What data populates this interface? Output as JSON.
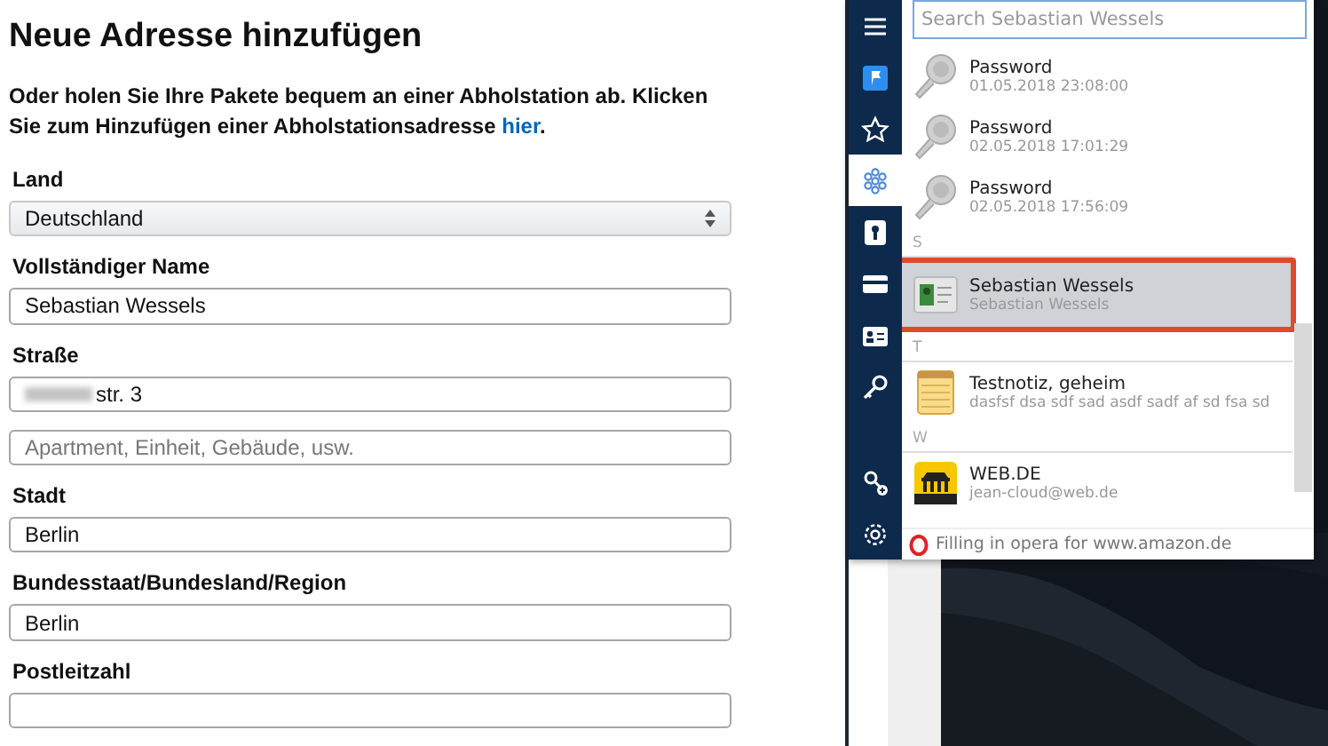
{
  "form": {
    "title": "Neue Adresse hinzufügen",
    "intro": "Oder holen Sie Ihre Pakete bequem an einer Abholstation ab. Klicken Sie zum Hinzufügen einer Abholstationsadresse",
    "intro_link": "hier",
    "intro_end": ".",
    "fields": [
      {
        "kind": "select",
        "label": "Land",
        "value": "Deutschland"
      },
      {
        "kind": "text",
        "label": "Vollständiger Name",
        "value": "Sebastian Wessels"
      },
      {
        "kind": "redacted",
        "label": "Straße",
        "value": "str. 3"
      },
      {
        "kind": "text",
        "placeholder": "Apartment, Einheit, Gebäude, usw."
      },
      {
        "kind": "text",
        "label": "Stadt",
        "value": "Berlin"
      },
      {
        "kind": "text",
        "label": "Bundesstaat/Bundesland/Region",
        "value": "Berlin"
      },
      {
        "kind": "text",
        "label": "Postleitzahl"
      }
    ]
  },
  "popup": {
    "sidebar": [
      {
        "kind": "menu",
        "selected": false
      },
      {
        "kind": "flag",
        "selected": false
      },
      {
        "kind": "star",
        "selected": false
      },
      {
        "kind": "network",
        "selected": true
      },
      {
        "kind": "keyhole",
        "selected": false
      },
      {
        "kind": "card",
        "selected": false
      },
      {
        "kind": "id",
        "selected": false
      },
      {
        "kind": "key",
        "selected": false
      },
      {
        "kind": "keyplus",
        "selected": false
      },
      {
        "kind": "settings",
        "selected": false
      }
    ],
    "search": {
      "placeholder": "Search Sebastian Wessels"
    },
    "items": [
      {
        "kind": "password",
        "title": "Password",
        "subtitle": "01.05.2018 23:08:00",
        "selected": false
      },
      {
        "kind": "password",
        "title": "Password",
        "subtitle": "02.05.2018 17:01:29",
        "selected": false
      },
      {
        "kind": "password",
        "title": "Password",
        "subtitle": "02.05.2018 17:56:09",
        "selected": false
      },
      {
        "kind": "header",
        "title": "S"
      },
      {
        "kind": "identity",
        "title": "Sebastian Wessels",
        "subtitle": "Sebastian Wessels",
        "selected": true
      },
      {
        "kind": "header",
        "title": "T"
      },
      {
        "kind": "note",
        "title": "Testnotiz, geheim",
        "subtitle": "dasfsf dsa sdf sad asdf sadf af sd fsa sd",
        "selected": false
      },
      {
        "kind": "header",
        "title": "W"
      },
      {
        "kind": "site",
        "title": "WEB.DE",
        "subtitle": "jean-cloud@web.de",
        "selected": false
      }
    ],
    "footer": "Filling in opera for www.amazon.de"
  }
}
